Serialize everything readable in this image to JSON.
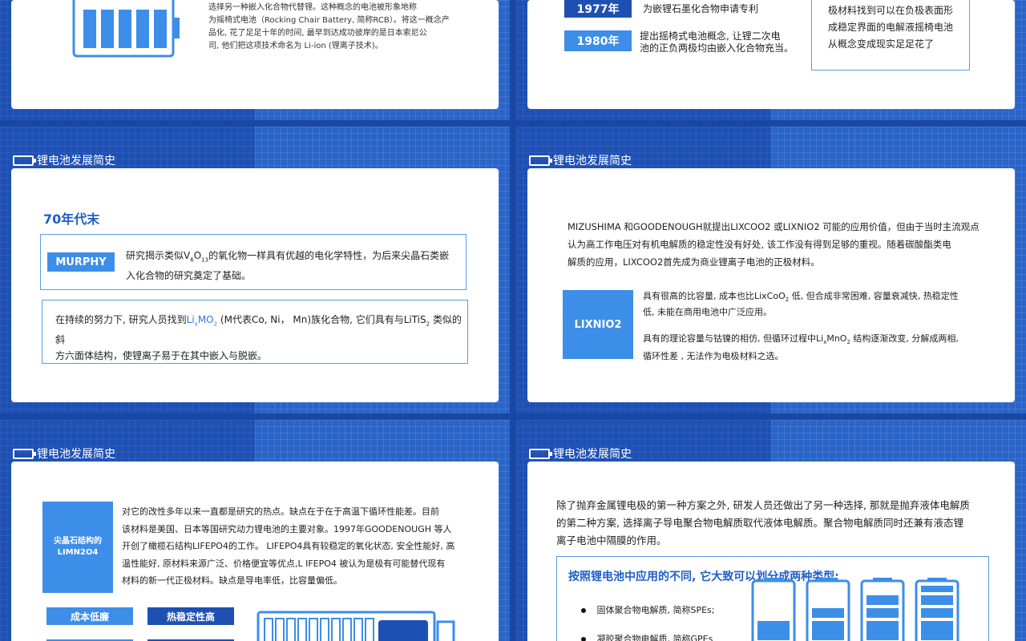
{
  "colors": {
    "background": "#1a47a6",
    "accent": "#1e5fc8",
    "light_accent": "#3d8ee8",
    "card": "#ffffff"
  },
  "slides": {
    "s1": {
      "line1": "选择另一种嵌入化合物代替锂。这种概念的电池被形象地称",
      "line2": "为摇椅式电池（Rocking Chair Battery, 简称RCB）。将这一概念产",
      "line3": "品化, 花了足足十年的时间, 最早到达成功彼岸的是日本索尼公",
      "line4": "司, 他们把这项技术命名为  Li-ion (锂离子技术)。"
    },
    "s2": {
      "year1": "1977年",
      "year1_text": "为嵌锂石墨化合物申请专利",
      "year2": "1980年",
      "year2_text_1": "提出摇椅式电池概念, 让锂二次电",
      "year2_text_2": "池的正负两极均由嵌入化合物充当。",
      "box_line1": "极材料找到可以在负极表面形",
      "box_line2": "成稳定界面的电解液摇椅电池",
      "box_line3": "从概念变成现实足足花了"
    },
    "s3": {
      "title": "锂电池发展简史",
      "heading": "70年代末",
      "tag": "MURPHY",
      "murphy_text_1a": "研究揭示类似V",
      "murphy_sub1": "6",
      "murphy_text_1b": "O",
      "murphy_sub2": "13",
      "murphy_text_1c": "的氧化物一样具有优越的电化学特性，为后来尖晶石类嵌",
      "murphy_text_2": "入化合物的研究奠定了基础。",
      "text2_1a": "在持续的努力下, 研究人员找到",
      "text2_li": "Li",
      "text2_x": "x",
      "text2_mo": "MO",
      "text2_2sub": "2",
      "text2_1b": " (M代表Co, Ni， Mn)族化合物, 它们具有与LiTiS",
      "text2_1c": " 类似的斜",
      "text2_2": "方六面体结构，使锂离子易于在其中嵌入与脱嵌。"
    },
    "s4": {
      "title": "锂电池发展简史",
      "p1": "MIZUSHIMA 和GOODENOUGH就提出LIXCOO2 或LIXNIO2 可能的应用价值，但由于当时主流观点",
      "p2": "认为高工作电压对有机电解质的稳定性没有好处, 该工作没有得到足够的重视。随着碳酸酯类电",
      "p3": "解质的应用，LIXCOO2首先成为商业锂离子电池的正极材料。",
      "tag": "LIXNIO2",
      "r1a": "具有很高的比容量, 成本也比LixCoO",
      "r1b": " 低, 但合成非常困难, 容量衰减快, 热稳定性",
      "r1c": "低, 未能在商用电池中广泛应用。",
      "r2a": "具有的理论容量与钴镍的相仿, 但循环过程中Li",
      "r2b": "MnO",
      "r2c": " 结构逐渐改变, 分解成两相,",
      "r2d": "循环性差 , 无法作为电极材料之选。"
    },
    "s5": {
      "title": "锂电池发展简史",
      "tag_l1": "尖晶石结构的",
      "tag_l2": "LIMN2O4",
      "t1": "对它的改性多年以来一直都是研究的热点。缺点在于在于高温下循环性能差。目前",
      "t2": "该材料是美国、日本等国研究动力锂电池的主要对象。1997年GOODENOUGH 等人",
      "t3": "开创了橄榄石结构LIFEPO4的工作。 LIFEPO4具有较稳定的氧化状态, 安全性能好, 高",
      "t4": "温性能好, 原材料来源广泛、价格便宜等优点,L IFEPO4 被认为是极有可能替代现有",
      "t5": "材料的新一代正极材料。缺点是导电率低，比容量偏低。",
      "btn1": "成本低廉",
      "btn2": "热稳定性高"
    },
    "s6": {
      "title": "锂电池发展简史",
      "p1": "除了抛弃金属锂电极的第一种方案之外, 研发人员还做出了另一种选择, 那就是抛弃液体电解质",
      "p2": "的第二种方案, 选择离子导电聚合物电解质取代液体电解质。聚合物电解质同时还兼有液态锂",
      "p3": "离子电池中隔膜的作用。",
      "box_title": "按照锂电池中应用的不同, 它大致可以划分成两种类型:",
      "item1": "固体聚合物电解质, 简称SPEs;",
      "item2": "凝胶聚合物电解质, 简称GPEs"
    }
  }
}
